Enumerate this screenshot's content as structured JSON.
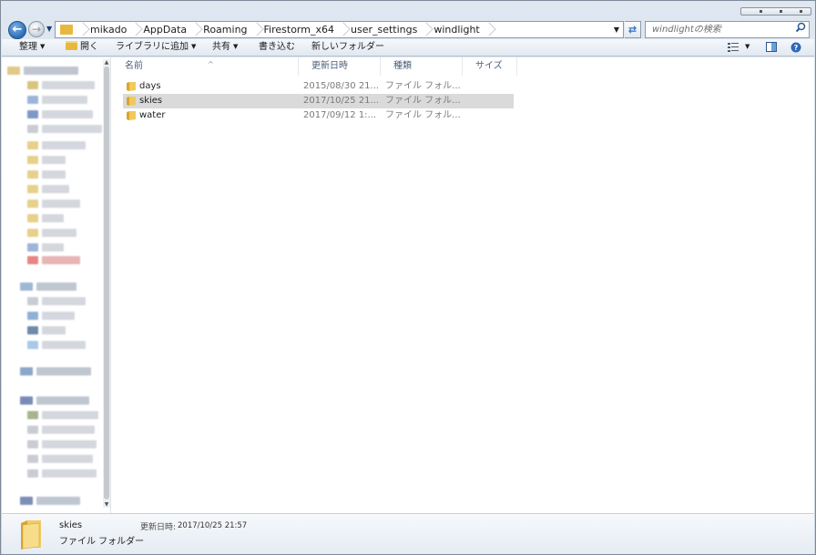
{
  "address": {
    "crumbs": [
      "mikado",
      "AppData",
      "Roaming",
      "Firestorm_x64",
      "user_settings",
      "windlight"
    ]
  },
  "search": {
    "placeholder": "windlightの検索"
  },
  "toolbar": {
    "organize": "整理",
    "open": "開く",
    "add_to_library": "ライブラリに追加",
    "share": "共有",
    "burn": "書き込む",
    "new_folder": "新しいフォルダー"
  },
  "columns": {
    "name": "名前",
    "modified": "更新日時",
    "type": "種類",
    "size": "サイズ"
  },
  "files": [
    {
      "name": "days",
      "modified": "2015/08/30 21...",
      "type": "ファイル フォル...",
      "selected": false
    },
    {
      "name": "skies",
      "modified": "2017/10/25 21...",
      "type": "ファイル フォル...",
      "selected": true
    },
    {
      "name": "water",
      "modified": "2017/09/12 1:...",
      "type": "ファイル フォル...",
      "selected": false
    }
  ],
  "details": {
    "name": "skies",
    "kind": "ファイル フォルダー",
    "modified_label": "更新日時:",
    "modified_value": "2017/10/25 21:57"
  },
  "colors": {
    "selection": "#dadada",
    "folder": "#e7b840",
    "header_text": "#4c607a",
    "accent_blue": "#2b6cb6"
  },
  "icons": {
    "back": "back-arrow-icon",
    "forward": "forward-arrow-icon",
    "refresh": "refresh-icon",
    "search": "search-icon",
    "folder": "folder-icon",
    "view": "view-options-icon",
    "preview": "preview-pane-icon",
    "help": "help-icon"
  }
}
